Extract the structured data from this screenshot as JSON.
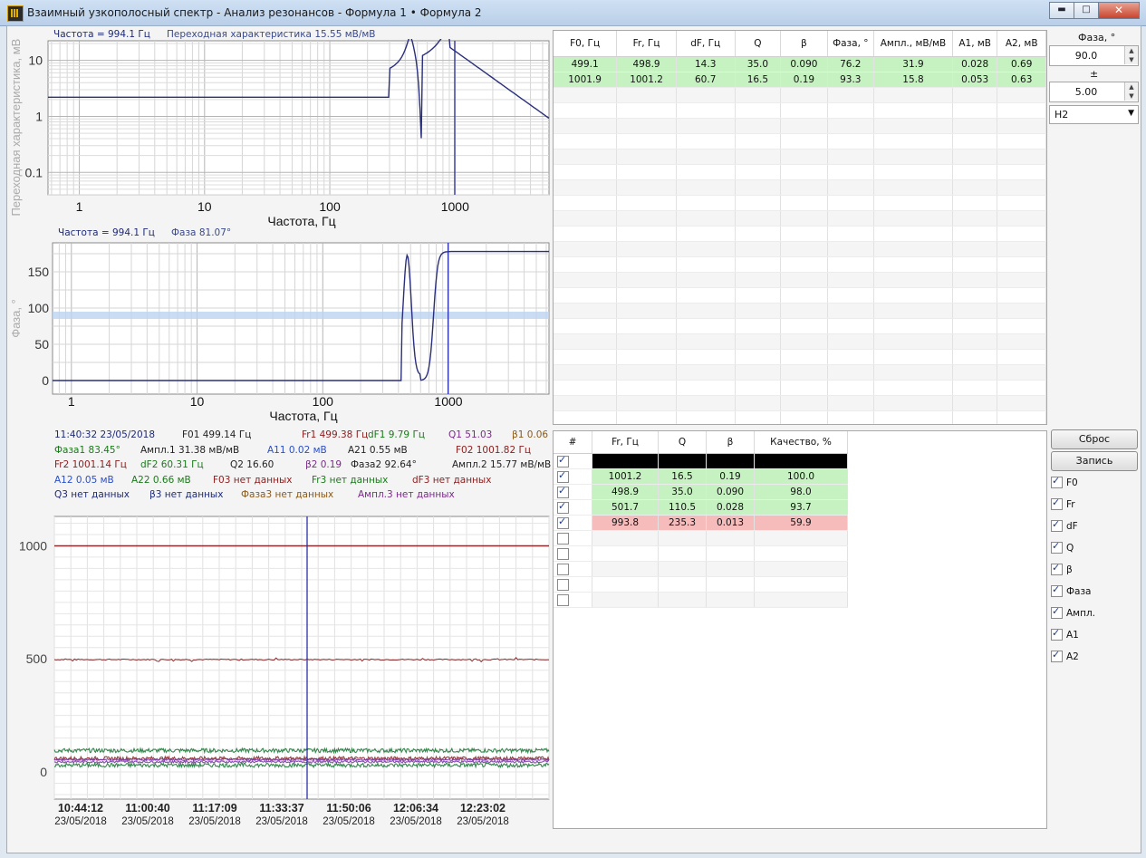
{
  "window": {
    "title": "Взаимный узкополосный спектр - Анализ резонансов - Формула 1 • Формула 2",
    "minimize": "▬",
    "maximize": "□",
    "close": "✕"
  },
  "plot1": {
    "cursor_freq": "Частота = 994.1 Гц",
    "readout": "Переходная характеристика 15.55 мВ/мВ",
    "ylabel": "Переходная характеристика, мВ/мВ",
    "xlabel": "Частота, Гц",
    "yticks": [
      "10",
      "1",
      "0.1"
    ],
    "xticks": [
      "1",
      "10",
      "100",
      "1000"
    ]
  },
  "plot2": {
    "cursor_freq": "Частота = 994.1 Гц",
    "readout": "Фаза 81.07°",
    "ylabel": "Фаза, °",
    "xlabel": "Частота, Гц",
    "yticks": [
      "150",
      "100",
      "50",
      "0"
    ],
    "xticks": [
      "1",
      "10",
      "100",
      "1000"
    ]
  },
  "info_rows": [
    [
      {
        "t": "11:40:32 23/05/2018",
        "c": "c-navy"
      },
      {
        "t": "F01 499.14 Гц",
        "c": "c-dark"
      },
      {
        "t": "Fr1 499.38 Гц",
        "c": "c-red"
      },
      {
        "t": "dF1 9.79 Гц",
        "c": "c-green"
      },
      {
        "t": "Q1 51.03",
        "c": "c-purple"
      },
      {
        "t": "β1 0.06",
        "c": "c-brown"
      }
    ],
    [
      {
        "t": "Фаза1 83.45°",
        "c": "c-green"
      },
      {
        "t": "Ампл.1 31.38 мВ/мВ",
        "c": "c-dark"
      },
      {
        "t": "A11 0.02 мВ",
        "c": "c-blue"
      },
      {
        "t": "A21 0.55 мВ",
        "c": "c-dark"
      },
      {
        "t": "F02 1001.82 Гц",
        "c": "c-red"
      }
    ],
    [
      {
        "t": "Fr2 1001.14 Гц",
        "c": "c-red"
      },
      {
        "t": "dF2 60.31 Гц",
        "c": "c-green"
      },
      {
        "t": "Q2 16.60",
        "c": "c-dark"
      },
      {
        "t": "β2 0.19",
        "c": "c-purple"
      },
      {
        "t": "Фаза2 92.64°",
        "c": "c-dark"
      },
      {
        "t": "Ампл.2 15.77 мВ/мВ",
        "c": "c-dark"
      }
    ],
    [
      {
        "t": "A12 0.05 мВ",
        "c": "c-blue"
      },
      {
        "t": "A22 0.66 мВ",
        "c": "c-green"
      },
      {
        "t": "F03 нет данных",
        "c": "c-red"
      },
      {
        "t": "Fr3 нет данных",
        "c": "c-green"
      },
      {
        "t": "dF3 нет данных",
        "c": "c-red"
      }
    ],
    [
      {
        "t": "Q3 нет данных",
        "c": "c-navy"
      },
      {
        "t": "β3 нет данных",
        "c": "c-navy"
      },
      {
        "t": "Фаза3 нет данных",
        "c": "c-brown"
      },
      {
        "t": "Ампл.3 нет данных",
        "c": "c-purple"
      }
    ]
  ],
  "trend": {
    "yticks": [
      "1000",
      "500",
      "0"
    ],
    "xticks": [
      {
        "time": "10:44:12",
        "date": "23/05/2018"
      },
      {
        "time": "11:00:40",
        "date": "23/05/2018"
      },
      {
        "time": "11:17:09",
        "date": "23/05/2018"
      },
      {
        "time": "11:33:37",
        "date": "23/05/2018"
      },
      {
        "time": "11:50:06",
        "date": "23/05/2018"
      },
      {
        "time": "12:06:34",
        "date": "23/05/2018"
      },
      {
        "time": "12:23:02",
        "date": "23/05/2018"
      }
    ]
  },
  "table1": {
    "headers": [
      "F0, Гц",
      "Fr, Гц",
      "dF, Гц",
      "Q",
      "β",
      "Фаза, °",
      "Ампл., мВ/мВ",
      "A1, мВ",
      "A2, мВ"
    ],
    "rows": [
      [
        "499.1",
        "498.9",
        "14.3",
        "35.0",
        "0.090",
        "76.2",
        "31.9",
        "0.028",
        "0.69"
      ],
      [
        "1001.9",
        "1001.2",
        "60.7",
        "16.5",
        "0.19",
        "93.3",
        "15.8",
        "0.053",
        "0.63"
      ]
    ]
  },
  "table2": {
    "headers": [
      "#",
      "Fr, Гц",
      "Q",
      "β",
      "Качество, %"
    ],
    "rows": [
      {
        "checked": true,
        "style": "k",
        "cells": [
          "",
          "",
          "",
          ""
        ]
      },
      {
        "checked": true,
        "style": "g",
        "cells": [
          "1001.2",
          "16.5",
          "0.19",
          "100.0"
        ]
      },
      {
        "checked": true,
        "style": "g",
        "cells": [
          "498.9",
          "35.0",
          "0.090",
          "98.0"
        ]
      },
      {
        "checked": true,
        "style": "g",
        "cells": [
          "501.7",
          "110.5",
          "0.028",
          "93.7"
        ]
      },
      {
        "checked": true,
        "style": "r",
        "cells": [
          "993.8",
          "235.3",
          "0.013",
          "59.9"
        ]
      },
      {
        "checked": false,
        "style": "",
        "cells": [
          "",
          "",
          "",
          ""
        ]
      },
      {
        "checked": false,
        "style": "",
        "cells": [
          "",
          "",
          "",
          ""
        ]
      },
      {
        "checked": false,
        "style": "",
        "cells": [
          "",
          "",
          "",
          ""
        ]
      },
      {
        "checked": false,
        "style": "",
        "cells": [
          "",
          "",
          "",
          ""
        ]
      },
      {
        "checked": false,
        "style": "",
        "cells": [
          "",
          "",
          "",
          ""
        ]
      }
    ]
  },
  "side": {
    "phase_label": "Фаза, °",
    "phase_value": "90.0",
    "pm_label": "±",
    "pm_value": "5.00",
    "select_value": "H2",
    "reset_button": "Сброс",
    "record_button": "Запись",
    "checks": [
      "F0",
      "Fr",
      "dF",
      "Q",
      "β",
      "Фаза",
      "Ампл.",
      "A1",
      "A2"
    ]
  },
  "colors": {
    "curve": "#2a2f7a",
    "cursor": "#2a2fa8",
    "phase_band": "#bcd3f0",
    "trend_red": "#8b2a2a",
    "trend_green": "#1f7a3a",
    "trend_purple": "#7a3aa8"
  }
}
